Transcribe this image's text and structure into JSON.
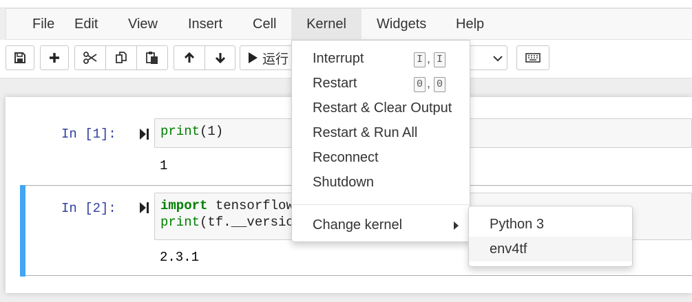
{
  "menubar": {
    "items": [
      {
        "label": "File"
      },
      {
        "label": "Edit"
      },
      {
        "label": "View"
      },
      {
        "label": "Insert"
      },
      {
        "label": "Cell"
      },
      {
        "label": "Kernel"
      },
      {
        "label": "Widgets"
      },
      {
        "label": "Help"
      }
    ],
    "active": "Kernel"
  },
  "toolbar": {
    "run_label": "运行",
    "icons": [
      "save-icon",
      "plus-icon",
      "scissors-icon",
      "copy-icon",
      "paste-icon",
      "arrow-up-icon",
      "arrow-down-icon",
      "play-icon",
      "chevron-down-icon",
      "keyboard-icon"
    ]
  },
  "cells": [
    {
      "prompt": "In  [1]:",
      "code_fn": "print",
      "code_rest": "(1)",
      "output": "1"
    },
    {
      "prompt": "In  [2]:",
      "code_kw": "import",
      "code_line1_rest": " tensorflow",
      "code_line2_fn": "print",
      "code_line2_rest": "(tf.__version_",
      "output": "2.3.1"
    }
  ],
  "kernel_menu": {
    "interrupt": "Interrupt",
    "interrupt_key": "I",
    "interrupt_sep": ",",
    "restart": "Restart",
    "restart_key": "0",
    "restart_sep": ",",
    "restart_clear": "Restart & Clear Output",
    "restart_run_all": "Restart & Run All",
    "reconnect": "Reconnect",
    "shutdown": "Shutdown",
    "change_kernel": "Change kernel"
  },
  "kernel_submenu": {
    "items": [
      {
        "label": "Python 3"
      },
      {
        "label": "env4tf"
      }
    ],
    "hovered": "env4tf"
  },
  "colors": {
    "selected_cell_bar": "#42a5f5",
    "prompt": "#303f9f",
    "keyword": "#008000"
  }
}
